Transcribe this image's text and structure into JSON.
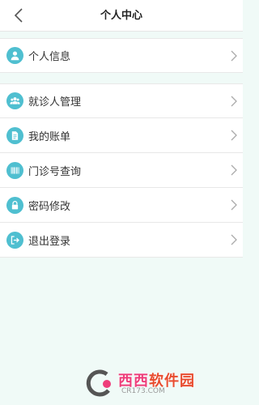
{
  "header": {
    "title": "个人中心"
  },
  "group1": [
    {
      "label": "个人信息",
      "icon": "user-icon"
    }
  ],
  "group2": [
    {
      "label": "就诊人管理",
      "icon": "group-icon"
    },
    {
      "label": "我的账单",
      "icon": "document-icon"
    },
    {
      "label": "门诊号查询",
      "icon": "barcode-icon"
    },
    {
      "label": "密码修改",
      "icon": "lock-icon"
    },
    {
      "label": "退出登录",
      "icon": "logout-icon"
    }
  ],
  "watermark": {
    "brand_a": "西西",
    "brand_b": "软件园",
    "url": "CR173.COM"
  },
  "colors": {
    "accent": "#4fbfd0",
    "background": "#f0faf7"
  }
}
